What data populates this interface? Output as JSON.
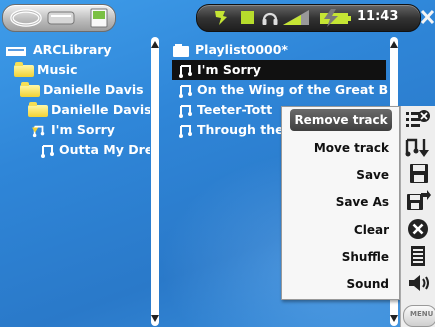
{
  "status": {
    "time": "11:43"
  },
  "left_panel": {
    "items": [
      {
        "label": "ARCLibrary",
        "type": "library"
      },
      {
        "label": "Music",
        "type": "folder"
      },
      {
        "label": "Danielle Davis",
        "type": "folder"
      },
      {
        "label": "Danielle Davis",
        "type": "folder"
      },
      {
        "label": "I'm Sorry",
        "type": "track"
      },
      {
        "label": "Outta My Dre",
        "type": "track"
      }
    ]
  },
  "playlist": {
    "title": "Playlist0000*",
    "tracks": [
      {
        "label": "I'm Sorry",
        "selected": true
      },
      {
        "label": "On the Wing of the Great Big",
        "selected": false
      },
      {
        "label": "Teeter-Tott",
        "selected": false
      },
      {
        "label": "Through the",
        "selected": false
      }
    ]
  },
  "context_menu": {
    "items": [
      {
        "label": "Remove track",
        "icon": "remove-track-icon",
        "selected": true
      },
      {
        "label": "Move track",
        "icon": "move-track-icon",
        "selected": false
      },
      {
        "label": "Save",
        "icon": "floppy-disk-icon",
        "selected": false
      },
      {
        "label": "Save As",
        "icon": "save-as-icon",
        "selected": false
      },
      {
        "label": "Clear",
        "icon": "clear-icon",
        "selected": false
      },
      {
        "label": "Shuffle",
        "icon": "shuffle-icon",
        "selected": false
      },
      {
        "label": "Sound",
        "icon": "speaker-icon",
        "selected": false
      }
    ],
    "menu_button": "MENU"
  },
  "colors": {
    "background": "#2f86d8",
    "highlight": "#111111",
    "folder": "#f2d133"
  }
}
